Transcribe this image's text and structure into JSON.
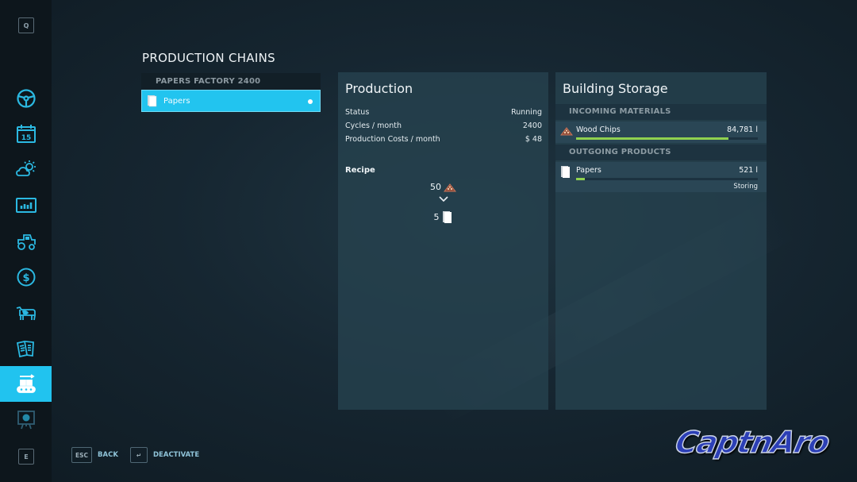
{
  "sidebar": {
    "top_key": "Q",
    "bottom_key": "E",
    "items": [
      {
        "icon": "steering-wheel-icon",
        "active": false
      },
      {
        "icon": "calendar-icon",
        "label": "15",
        "active": false
      },
      {
        "icon": "weather-icon",
        "active": false
      },
      {
        "icon": "statistics-icon",
        "active": false
      },
      {
        "icon": "tractor-icon",
        "active": false
      },
      {
        "icon": "dollar-icon",
        "active": false
      },
      {
        "icon": "cow-icon",
        "active": false
      },
      {
        "icon": "contracts-icon",
        "active": false
      },
      {
        "icon": "production-chain-icon",
        "active": true
      },
      {
        "icon": "tour-presentation-icon",
        "active": false
      }
    ]
  },
  "page_title": "PRODUCTION CHAINS",
  "chains": {
    "header": "PAPERS FACTORY 2400",
    "items": [
      {
        "label": "Papers",
        "icon": "papers-icon",
        "selected": true
      }
    ]
  },
  "production": {
    "title": "Production",
    "rows": [
      {
        "label": "Status",
        "value": "Running"
      },
      {
        "label": "Cycles / month",
        "value": "2400"
      },
      {
        "label": "Production Costs / month",
        "value": "$ 48"
      }
    ],
    "recipe_label": "Recipe",
    "recipe_input": {
      "amount": "50",
      "icon": "wood-chips-icon"
    },
    "recipe_arrow": "chevron-down-icon",
    "recipe_output": {
      "amount": "5",
      "icon": "papers-icon"
    }
  },
  "storage": {
    "title": "Building Storage",
    "incoming_header": "INCOMING MATERIALS",
    "incoming": [
      {
        "name": "Wood Chips",
        "amount": "84,781 l",
        "fill_percent": 84,
        "icon": "wood-chips-icon"
      }
    ],
    "outgoing_header": "OUTGOING PRODUCTS",
    "outgoing": [
      {
        "name": "Papers",
        "amount": "521 l",
        "fill_percent": 5,
        "state": "Storing",
        "icon": "papers-icon"
      }
    ]
  },
  "footer": {
    "back": {
      "key": "ESC",
      "label": "BACK"
    },
    "deactivate": {
      "key": "↵",
      "label": "DEACTIVATE"
    }
  },
  "watermark": "CaptnAro",
  "colors": {
    "accent": "#22c4ef",
    "bar_fill": "#8fd14f",
    "panel": "#264250"
  }
}
